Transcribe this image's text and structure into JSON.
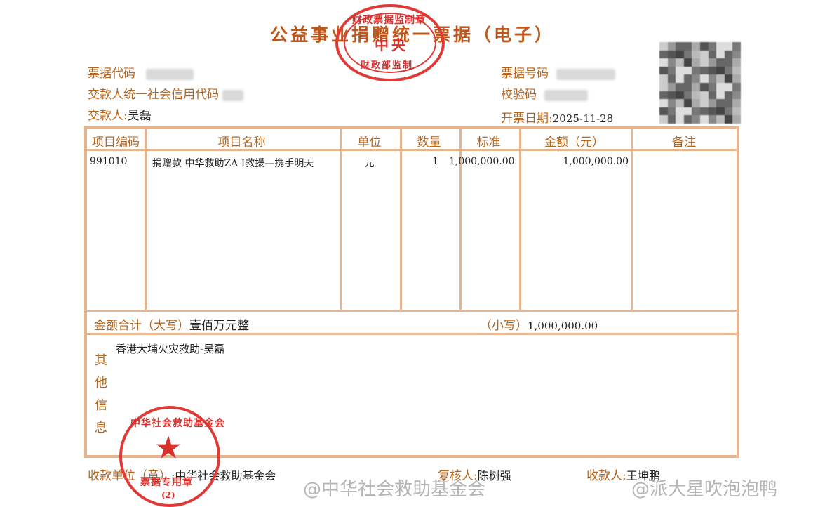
{
  "title": "公益事业捐赠统一票据（电子）",
  "header": {
    "code_label": "票据代码",
    "credit_label": "交款人统一社会信用代码",
    "payer_label": "交款人:",
    "payer_value": "吴磊",
    "number_label": "票据号码",
    "check_label": "校验码",
    "date_label": "开票日期:",
    "date_value": "2025-11-28"
  },
  "table": {
    "columns": [
      "项目编码",
      "项目名称",
      "单位",
      "数量",
      "标准",
      "金额（元）",
      "备注"
    ],
    "rows": [
      {
        "code": "991010",
        "name": "捐赠款  中华救助ZA I救援—携手明天",
        "unit": "元",
        "qty": "1",
        "standard": "1,000,000.00",
        "amount": "1,000,000.00",
        "note": ""
      }
    ],
    "total_upper_label": "金额合计（大写）",
    "total_upper_value": "壹佰万元整",
    "total_lower_label": "（小写）",
    "total_lower_value": "1,000,000.00"
  },
  "other_info": {
    "label_chars": [
      "其",
      "他",
      "信",
      "息"
    ],
    "text": "香港大埔火灾救助-吴磊"
  },
  "footer": {
    "receiver_label": "收款单位（章）",
    "receiver_value": ":中华社会救助基金会",
    "reviewer_label": "复核人:",
    "reviewer_value": "陈树强",
    "payee_label": "收款人:",
    "payee_value": "王坤鹏"
  },
  "stamps": {
    "top_outer": "财政票据监制章",
    "top_center": "中央",
    "top_bottom": "财政部监制",
    "bottom_outer": "中华社会救助基金会",
    "bottom_inner": "票据专用章",
    "bottom_num": "(2)"
  },
  "watermarks": {
    "left": "@中华社会救助基金会",
    "right": "@派大星吹泡泡鸭"
  },
  "colors": {
    "label": "#b5651d",
    "border": "#e8b48e",
    "stamp": "#e03a36"
  }
}
